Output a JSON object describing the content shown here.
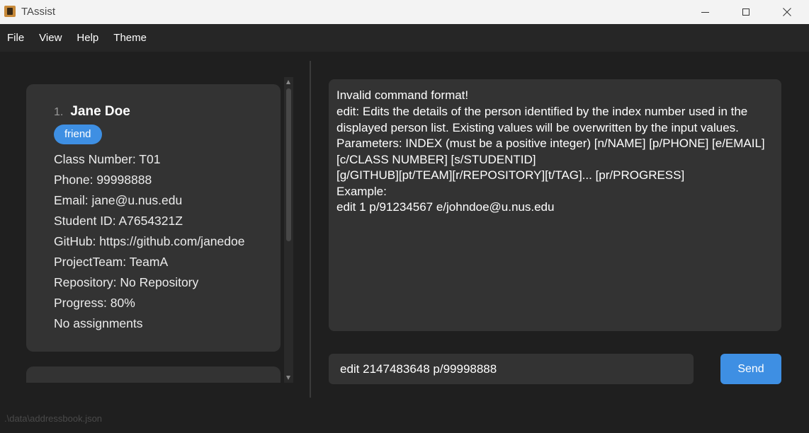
{
  "window": {
    "title": "TAssist"
  },
  "menu": [
    "File",
    "View",
    "Help",
    "Theme"
  ],
  "person_list": {
    "cards": [
      {
        "index": "1.",
        "name": "Jane Doe",
        "tags": [
          "friend"
        ],
        "fields": [
          "Class Number: T01",
          "Phone: 99998888",
          "Email: jane@u.nus.edu",
          "Student ID: A7654321Z",
          "GitHub: https://github.com/janedoe",
          "ProjectTeam: TeamA",
          "Repository: No Repository",
          "Progress: 80%",
          "No assignments"
        ]
      }
    ]
  },
  "result_display": {
    "lines": [
      "Invalid command format!",
      "edit: Edits the details of the person identified by the index number used in the",
      "displayed person list. Existing values will be overwritten by the input values.",
      "Parameters: INDEX (must be a positive integer) [n/NAME] [p/PHONE] [e/EMAIL]",
      "[c/CLASS NUMBER] [s/STUDENTID]",
      "[g/GITHUB][pt/TEAM][r/REPOSITORY][t/TAG]... [pr/PROGRESS]",
      "Example:",
      "edit 1 p/91234567 e/johndoe@u.nus.edu"
    ]
  },
  "command_box": {
    "value": "edit 2147483648 p/99998888"
  },
  "send_button": {
    "label": "Send"
  },
  "status_bar": {
    "file_path": ".\\data\\addressbook.json"
  },
  "colors": {
    "accent": "#3e8fe3",
    "background": "#1f1f1f",
    "panel": "#333333"
  },
  "icons": {
    "minimize": "minimize-icon",
    "maximize": "maximize-icon",
    "close": "close-icon",
    "app": "app-icon"
  }
}
